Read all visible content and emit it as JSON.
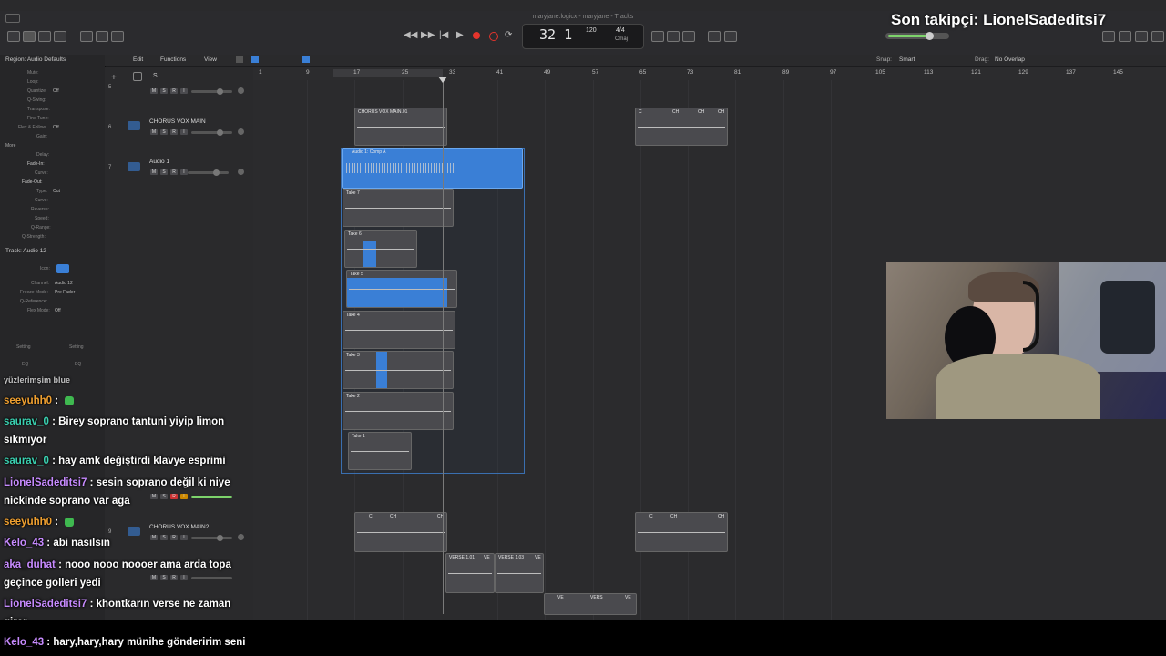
{
  "window": {
    "title": "maryjane.logicx - maryjane - Tracks"
  },
  "overlay": {
    "follower_text": "Son takipçi: LionelSadeditsi7"
  },
  "lcd": {
    "position": "32 1",
    "tempo": "120",
    "time_signature": "4/4",
    "key": "Cmaj"
  },
  "arrange_menu": {
    "edit": "Edit",
    "functions": "Functions",
    "view": "View",
    "snap_label": "Snap:",
    "snap_value": "Smart",
    "drag_label": "Drag:",
    "drag_value": "No Overlap"
  },
  "inspector": {
    "region_header": "Region: Audio Defaults",
    "track_header": "Track: Audio 12",
    "region_rows": [
      {
        "label": "Mute:",
        "value": ""
      },
      {
        "label": "Loop:",
        "value": ""
      },
      {
        "label": "Quantize:",
        "value": "Off"
      },
      {
        "label": "Q-Swing:",
        "value": ""
      },
      {
        "label": "Transpose:",
        "value": ""
      },
      {
        "label": "Fine Tune:",
        "value": ""
      },
      {
        "label": "Flex & Follow:",
        "value": "Off"
      },
      {
        "label": "Gain:",
        "value": ""
      }
    ],
    "more_label": "More",
    "more_rows": [
      {
        "label": "Delay:",
        "value": ""
      },
      {
        "label": "Fade-In:",
        "value": ""
      },
      {
        "label": "Curve:",
        "value": ""
      },
      {
        "label": "Fade-Out:",
        "value": ""
      },
      {
        "label": "Type:",
        "value": "Out"
      },
      {
        "label": "Curve:",
        "value": ""
      },
      {
        "label": "Reverse:",
        "value": ""
      },
      {
        "label": "Speed:",
        "value": ""
      },
      {
        "label": "Q-Range:",
        "value": ""
      },
      {
        "label": "Q-Strength:",
        "value": ""
      }
    ],
    "track_rows": [
      {
        "label": "Icon:",
        "value": ""
      },
      {
        "label": "Channel:",
        "value": "Audio 12"
      },
      {
        "label": "Freeze Mode:",
        "value": "Pre Fader"
      },
      {
        "label": "Q-Reference:",
        "value": ""
      },
      {
        "label": "Flex Mode:",
        "value": "Off"
      }
    ],
    "setting_left": "Setting",
    "setting_right": "Setting",
    "eq_left": "EQ",
    "eq_right": "EQ"
  },
  "ruler": [
    "1",
    "9",
    "17",
    "25",
    "33",
    "41",
    "49",
    "57",
    "65",
    "73",
    "81",
    "89",
    "97",
    "105",
    "113",
    "121",
    "129",
    "137",
    "145"
  ],
  "tracks": [
    {
      "num": "5",
      "name": ""
    },
    {
      "num": "6",
      "name": "CHORUS VOX MAIN"
    },
    {
      "num": "7",
      "name": "Audio 1"
    },
    {
      "num": "9",
      "name": "CHORUS VOX MAIN2"
    }
  ],
  "msr": {
    "m": "M",
    "s": "S",
    "r": "R",
    "i": "I"
  },
  "regions": {
    "chorus_main": "CHORUS VOX MAIN.01",
    "comp": "Audio 1: Comp A",
    "take7": "Take 7",
    "take6": "Take 6",
    "take5": "Take 5",
    "take4": "Take 4",
    "take3": "Take 3",
    "take2": "Take 2",
    "take1": "Take 1",
    "verse1": "VERSE 1.01",
    "verse2": "VERSE 1.03",
    "ch": "CH",
    "c": "C",
    "ve": "VE",
    "vers": "VERS"
  },
  "chat": [
    {
      "user": "seeyuhh0",
      "color": "#f0a030",
      "text": " : ",
      "badge": true
    },
    {
      "user": "saurav_0",
      "color": "#3ad0b0",
      "text": " : Birey soprano tantuni yiyip limon"
    },
    {
      "user": "",
      "color": "#ffffff",
      "text": "sıkmıyor"
    },
    {
      "user": "saurav_0",
      "color": "#3ad0b0",
      "text": " : hay amk değiştirdi klavye esprimi"
    },
    {
      "user": "LionelSadeditsi7",
      "color": "#c78bff",
      "text": " : sesin soprano değil ki niye"
    },
    {
      "user": "",
      "color": "#ffffff",
      "text": "nickinde soprano var aga"
    },
    {
      "user": "seeyuhh0",
      "color": "#f0a030",
      "text": " : ",
      "badge": true
    },
    {
      "user": "Kelo_43",
      "color": "#c78bff",
      "text": " : abi nasılsın"
    },
    {
      "user": "aka_duhat",
      "color": "#c78bff",
      "text": " : nooo nooo noooer ama arda topa"
    },
    {
      "user": "",
      "color": "#ffffff",
      "text": "geçince golleri yedi"
    },
    {
      "user": "LionelSadeditsi7",
      "color": "#c78bff",
      "text": " : khontkarın verse ne zaman"
    },
    {
      "user": "",
      "color": "#ffffff",
      "text": "girer"
    },
    {
      "user": "Kelo_43",
      "color": "#c78bff",
      "text": " : hary,hary,hary münihe gönderirim seni"
    }
  ],
  "chat_partial_top": "yüzlerimşim blue",
  "colors": {
    "accent_blue": "#3a7fd6",
    "record_red": "#e5342c",
    "volume_green": "#7dd36b"
  }
}
